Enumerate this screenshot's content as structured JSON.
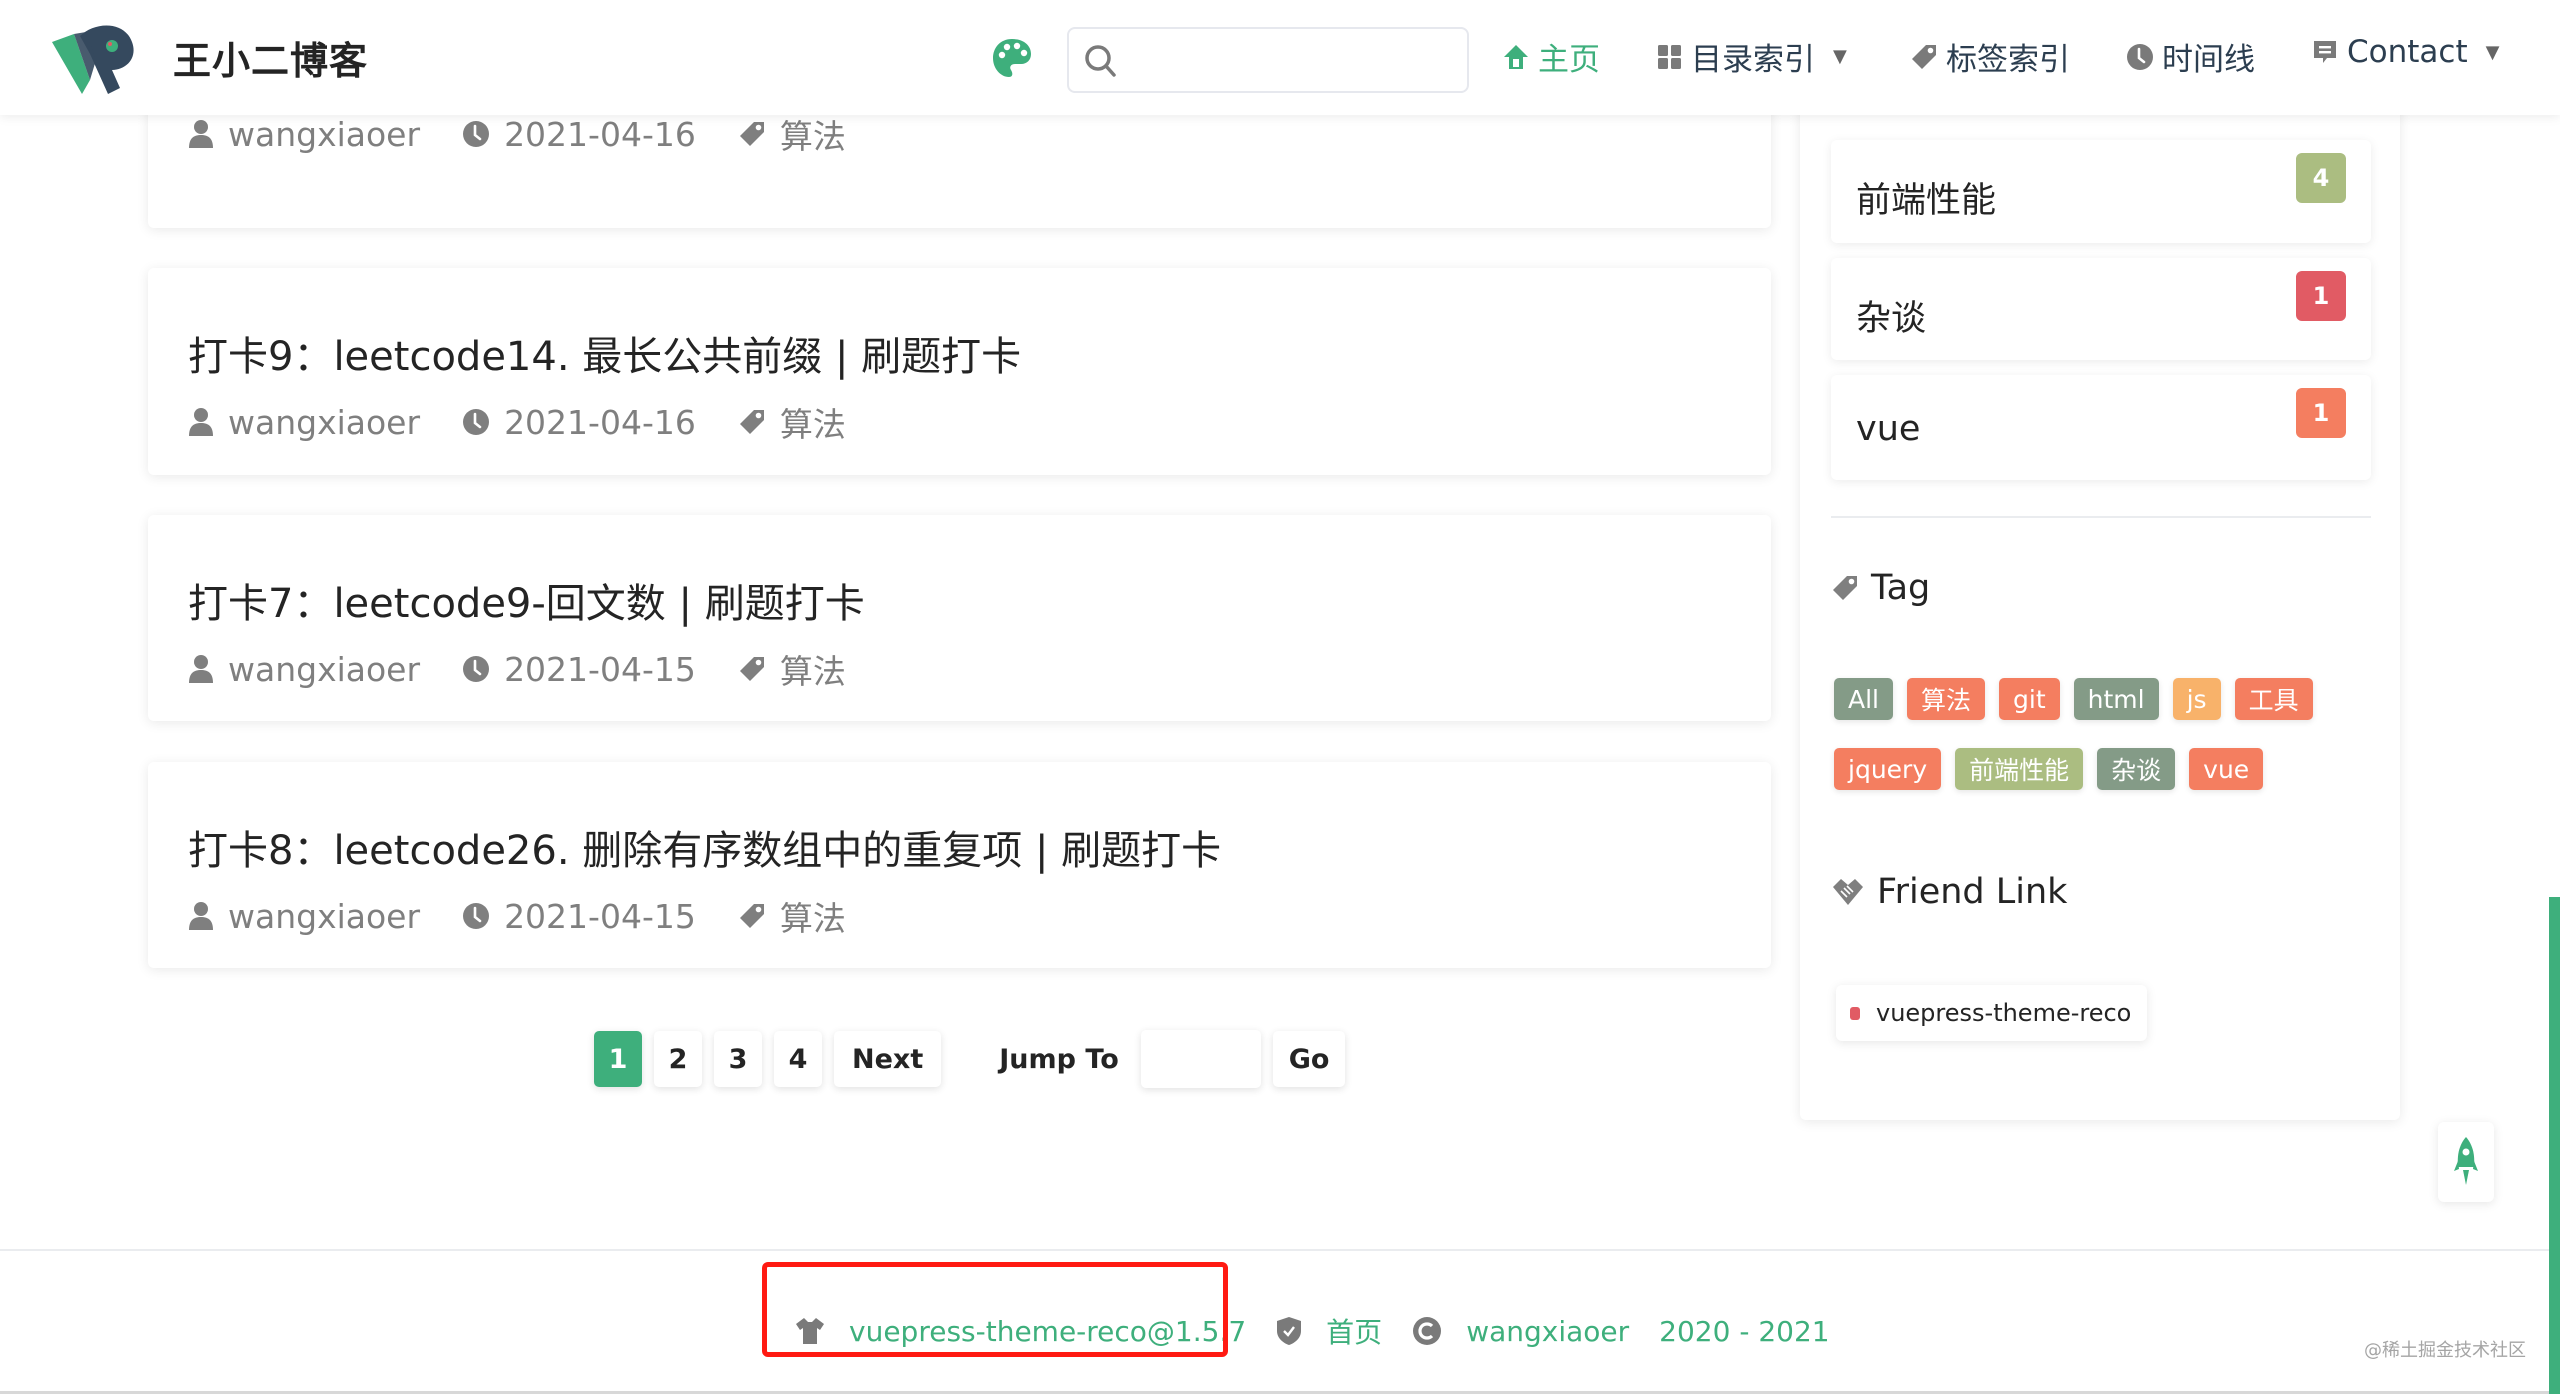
{
  "header": {
    "site_title": "王小二博客",
    "search": {
      "value": "",
      "placeholder": ""
    },
    "nav": [
      {
        "label": "主页",
        "icon": "home-icon",
        "active": true
      },
      {
        "label": "目录索引",
        "icon": "grid-icon",
        "dropdown": true
      },
      {
        "label": "标签索引",
        "icon": "tag-icon"
      },
      {
        "label": "时间线",
        "icon": "clock-icon"
      },
      {
        "label": "Contact",
        "icon": "message-icon",
        "dropdown": true
      }
    ],
    "caret": "▼"
  },
  "articles": [
    {
      "title": "",
      "author": "wangxiaoer",
      "date": "2021-04-16",
      "tag": "算法"
    },
    {
      "title": "打卡9：leetcode14. 最长公共前缀 | 刷题打卡",
      "author": "wangxiaoer",
      "date": "2021-04-16",
      "tag": "算法"
    },
    {
      "title": "打卡7：leetcode9-回文数 | 刷题打卡",
      "author": "wangxiaoer",
      "date": "2021-04-15",
      "tag": "算法"
    },
    {
      "title": "打卡8：leetcode26. 删除有序数组中的重复项 | 刷题打卡",
      "author": "wangxiaoer",
      "date": "2021-04-15",
      "tag": "算法"
    }
  ],
  "pagination": {
    "pages": [
      "1",
      "2",
      "3",
      "4"
    ],
    "current": "1",
    "next_label": "Next",
    "jump_label": "Jump To",
    "jump_value": "",
    "go_label": "Go"
  },
  "sidebar": {
    "categories": [
      {
        "name": "前端性能",
        "count": "4",
        "color": "#abbd81"
      },
      {
        "name": "杂谈",
        "count": "1",
        "color": "#e15b64"
      },
      {
        "name": "vue",
        "count": "1",
        "color": "#f47e60"
      }
    ],
    "tag_heading": "Tag",
    "tags": [
      {
        "label": "All",
        "color": "#849b87"
      },
      {
        "label": "算法",
        "color": "#f47e60"
      },
      {
        "label": "git",
        "color": "#f47e60"
      },
      {
        "label": "html",
        "color": "#849b87"
      },
      {
        "label": "js",
        "color": "#f8b26a"
      },
      {
        "label": "工具",
        "color": "#f47e60"
      },
      {
        "label": "jquery",
        "color": "#f47e60"
      },
      {
        "label": "前端性能",
        "color": "#abbd81"
      },
      {
        "label": "杂谈",
        "color": "#849b87"
      },
      {
        "label": "vue",
        "color": "#f47e60"
      }
    ],
    "friend_heading": "Friend Link",
    "friend_links": [
      {
        "label": "vuepress-theme-reco",
        "color": "#e15b64"
      }
    ]
  },
  "footer": {
    "theme": "vuepress-theme-reco@1.5.7",
    "home": "首页",
    "author": "wangxiaoer",
    "years": "2020 - 2021"
  },
  "watermark": "@稀土掘金技术社区",
  "colors": {
    "accent": "#3eaf7c",
    "highlight": "#ff1a12"
  }
}
